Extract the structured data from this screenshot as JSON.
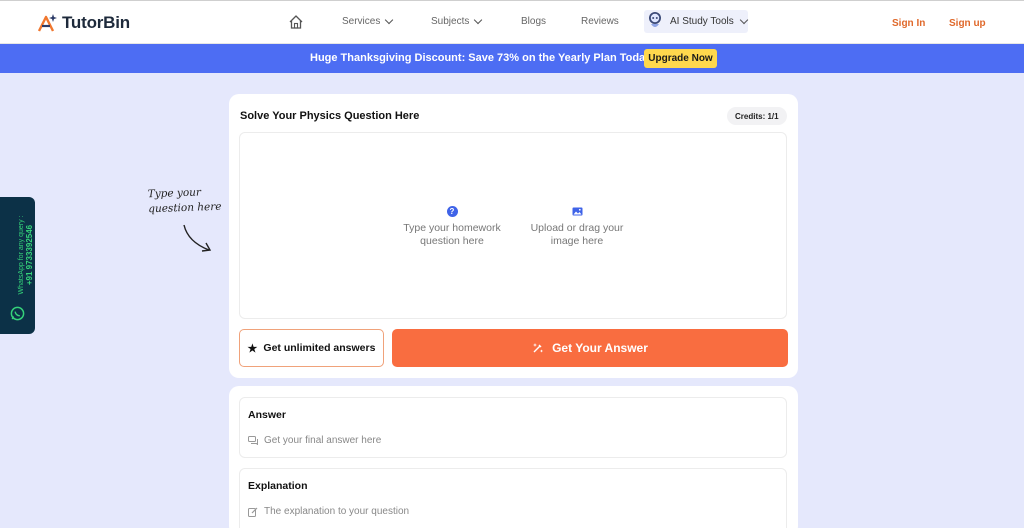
{
  "header": {
    "brand": "TutorBin",
    "nav": {
      "home_icon": "home-icon",
      "services": "Services",
      "subjects": "Subjects",
      "blogs": "Blogs",
      "reviews": "Reviews",
      "ai_tools": "AI Study Tools"
    },
    "sign_in": "Sign In",
    "sign_up": "Sign up"
  },
  "banner": {
    "text": "Huge Thanksgiving Discount: Save 73% on the Yearly Plan Today!",
    "button": "Upgrade Now"
  },
  "solver": {
    "title": "Solve Your Physics Question Here",
    "credits": "Credits: 1/1",
    "type_option": "Type your homework question here",
    "upload_option": "Upload or drag your image here",
    "unlimited_button": "Get unlimited answers",
    "answer_button": "Get Your Answer"
  },
  "results": {
    "answer_title": "Answer",
    "answer_hint": "Get your final answer here",
    "explanation_title": "Explanation",
    "explanation_hint": "The explanation to your question"
  },
  "note": {
    "line1": "Type your",
    "line2": "question here"
  },
  "whatsapp": {
    "line1": "WhatsApp for any query :",
    "line2": "+91 9733392546"
  },
  "colors": {
    "accent_orange": "#f96d40",
    "banner_blue": "#4d6df3",
    "upgrade_yellow": "#ffd84d",
    "page_bg": "#e5e8fc",
    "whatsapp_bg": "#0c3147"
  }
}
